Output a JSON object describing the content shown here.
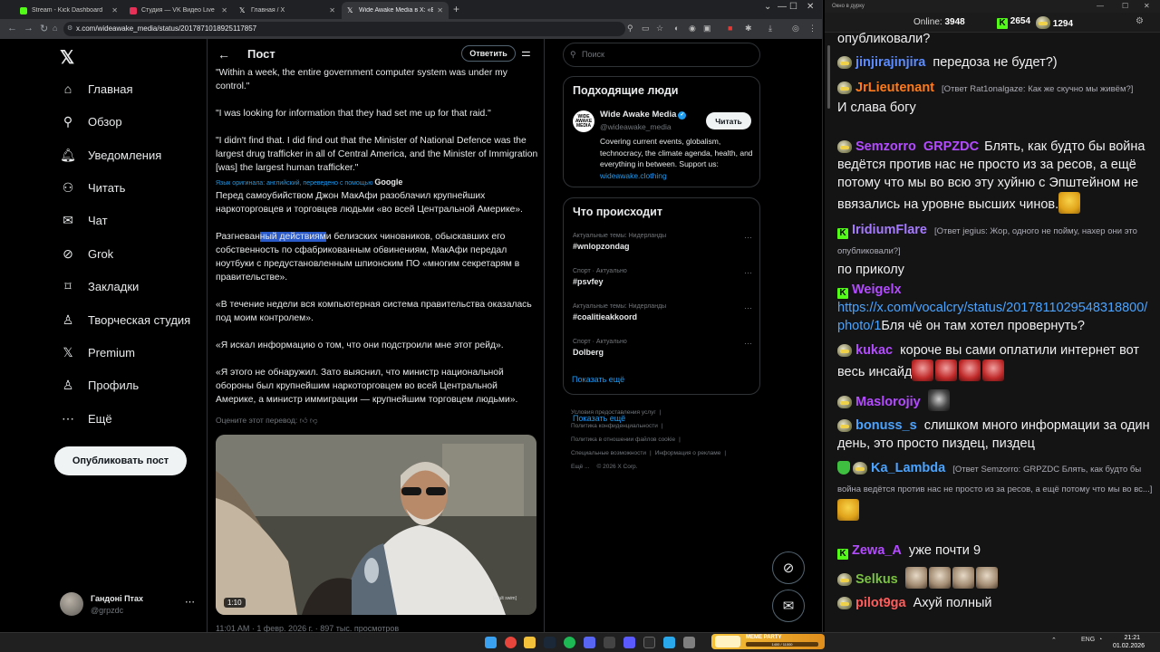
{
  "browser": {
    "tabs": [
      {
        "title": "Stream - Kick Dashboard",
        "color": "#53fc18"
      },
      {
        "title": "Студия — VK Видео Live",
        "color": "#e53157"
      },
      {
        "title": "Главная / X",
        "color": "#ffffff"
      },
      {
        "title": "Wide Awake Media в X: «Before",
        "color": "#ffffff"
      }
    ],
    "url": "x.com/wideawake_media/status/2017871018925117857"
  },
  "left_nav": {
    "items": [
      {
        "icon": "home-icon",
        "glyph": "⌂",
        "label": "Главная"
      },
      {
        "icon": "search-icon",
        "glyph": "⚲",
        "label": "Обзор"
      },
      {
        "icon": "bell-icon",
        "glyph": "🔔︎",
        "label": "Уведомления"
      },
      {
        "icon": "follow-icon",
        "glyph": "⚇",
        "label": "Читать"
      },
      {
        "icon": "mail-icon",
        "glyph": "✉",
        "label": "Чат"
      },
      {
        "icon": "grok-icon",
        "glyph": "⊘",
        "label": "Grok"
      },
      {
        "icon": "bookmark-icon",
        "glyph": "⌑",
        "label": "Закладки"
      },
      {
        "icon": "studio-icon",
        "glyph": "♙",
        "label": "Творческая студия"
      },
      {
        "icon": "x-premium-icon",
        "glyph": "𝕏",
        "label": "Premium"
      },
      {
        "icon": "profile-icon",
        "glyph": "♙",
        "label": "Профиль"
      },
      {
        "icon": "more-icon",
        "glyph": "⋯",
        "label": "Ещё"
      }
    ],
    "post_button": "Опубликовать пост",
    "account": {
      "name": "Гандоні Птах",
      "handle": "@grpzdc"
    }
  },
  "post": {
    "header_title": "Пост",
    "reply_button": "Ответить",
    "paragraphs": [
      "\"Within a week, the entire government computer system was under my control.\"",
      "\"I was looking for information that they had set me up for that raid.\"",
      "\"I didn't find that. I did find out that the Minister of National Defence was the largest drug trafficker in all of Central America, and the Minister of Immigration [was] the largest human trafficker.\""
    ],
    "translation_note": "Язык оригинала: английский, переведено с помощью",
    "translation_brand": "Google",
    "translated": [
      "Перед самоубийством Джон МакАфи разоблачил крупнейших наркоторговцев и торговцев людьми «во всей Центральной Америке».",
      "«В течение недели вся компьютерная система правительства оказалась под моим контролем».",
      "«Я искал информацию о том, что они подстроили мне этот рейд».",
      "«Я этого не обнаружил. Зато выяснил, что министр национальной обороны был крупнейшим наркоторговцем во всей Центральной Америке, а министр иммиграции — крупнейшим торговцем людьми»."
    ],
    "highlight_para": {
      "before": "Разгневан",
      "highlight": "ный действиям",
      "after": "и белизских чиновников, обыскавших его собственность по сфабрикованным обвинениям, МакАфи передал ноутбуки с предустановленным шпионским ПО «многим секретарям в правительстве»."
    },
    "rate_translation": "Оцените этот перевод:",
    "video": {
      "duration": "1:10",
      "watermark": "[adult swim]"
    },
    "timestamp": "11:01 AM · 1 февр. 2026 г. · 897 тыс. просмотров"
  },
  "right": {
    "search_placeholder": "Поиск",
    "people": {
      "title": "Подходящие люди",
      "name": "Wide Awake Media",
      "avatar_text": "WIDE AWAKE MEDIA",
      "handle": "@wideawake_media",
      "bio": "Covering current events, globalism, technocracy, the climate agenda, health, and everything in between. Support us:",
      "bio_link": "wideawake.clothing",
      "follow": "Читать"
    },
    "trends": {
      "title": "Что происходит",
      "items": [
        {
          "meta": "Актуальные темы: Нидерланды",
          "tag": "#wnlopzondag"
        },
        {
          "meta": "Спорт · Актуально",
          "tag": "#psvfey"
        },
        {
          "meta": "Актуальные темы: Нидерланды",
          "tag": "#coalitieakkoord"
        },
        {
          "meta": "Спорт · Актуально",
          "tag": "Dolberg"
        }
      ],
      "show_more": "Показать ещё"
    },
    "footer": [
      "Условия предоставления услуг",
      "Политика конфиденциальности",
      "Политика в отношении файлов cookie",
      "Специальные возможности",
      "Информация о рекламе",
      "Ещё ...",
      "© 2026 X Corp."
    ]
  },
  "chat": {
    "window_title": "Окно в дурку",
    "online_label": "Online:",
    "online": "3948",
    "kick_count": "2654",
    "vk_count": "1294",
    "messages": [
      {
        "text": "опубликовали?"
      },
      {
        "user": "jinjirajinjira",
        "color": "#5b8cff",
        "text": "передоза не будет?)"
      },
      {
        "user": "JrLieutenant",
        "color": "#ff7a1a",
        "reply": "[Ответ Rat1onalgaze: Как же скучно мы живём?]",
        "text": "И слава богу"
      },
      {
        "user": "Semzorro",
        "user2": "GRPZDC",
        "color": "#b34bff",
        "text": "Блять, как будто бы война ведётся против нас не просто из за ресов, а ещё потому что мы во всю эту хуйню с Эпштейном не ввязались на уровне высших чинов."
      },
      {
        "user": "IridiumFlare",
        "color": "#a67aff",
        "reply": "[Ответ jegius: Жор, одного не пойму, нахер они это опубликовали?]",
        "text": "по приколу"
      },
      {
        "user": "Weigelx",
        "color": "#b34bff",
        "link": "https://x.com/vocalcry/status/2017811029548318800/photo/1",
        "text": "Бля чё он там хотел провернуть?"
      },
      {
        "user": "kukac",
        "color": "#b34bff",
        "text": "короче вы сами оплатили интернет вот весь инсайд"
      },
      {
        "user": "Maslorojiy",
        "color": "#b34bff",
        "text": ""
      },
      {
        "user": "bonuss_s",
        "color": "#4aa3ff",
        "text": "слишком много информации за один день, это просто пиздец, пиздец"
      },
      {
        "user": "Ka_Lambda",
        "color": "#4aa3ff",
        "reply": "[Ответ Semzorro: GRPZDC Блять, как будто бы война ведётся против нас не просто из за ресов, а ещё потому что мы во вс...]",
        "text": ""
      },
      {
        "user": "Zewa_A",
        "color": "#b34bff",
        "text": "уже почти 9"
      },
      {
        "user": "Selkus",
        "color": "#7ac142",
        "text": ""
      },
      {
        "user": "pilot9ga",
        "color": "#ff5c5c",
        "text": "Ахуй полный"
      }
    ]
  },
  "taskbar": {
    "widget_title": "MEME PARTY",
    "widget_progress": "1400 / 11000",
    "lang": "ENG",
    "time": "21:21",
    "date": "01.02.2026"
  }
}
